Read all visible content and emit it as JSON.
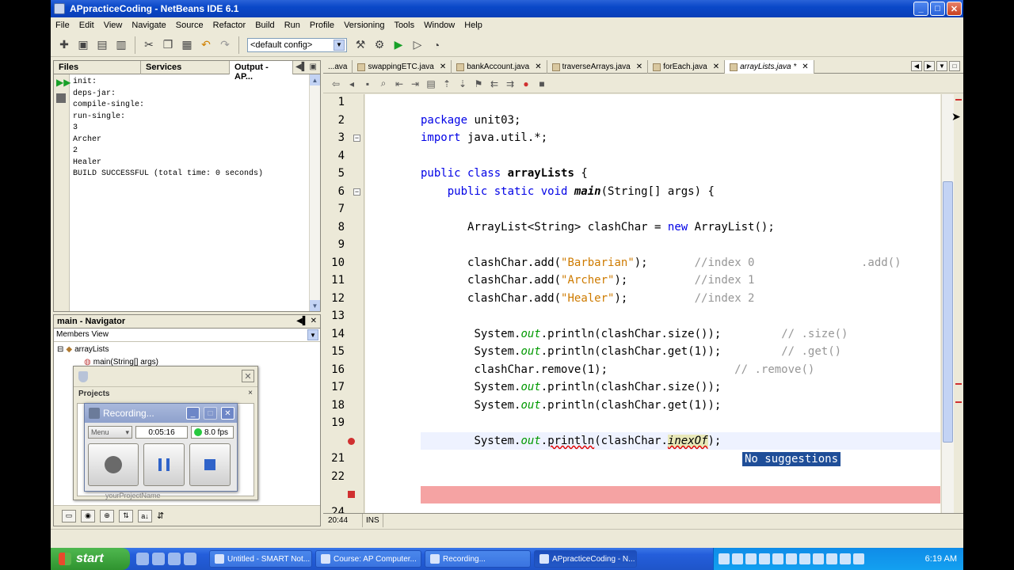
{
  "window": {
    "title": "APpracticeCoding - NetBeans IDE 6.1",
    "minimize": "_",
    "maximize": "□",
    "close": "✕"
  },
  "menu": [
    "File",
    "Edit",
    "View",
    "Navigate",
    "Source",
    "Refactor",
    "Build",
    "Run",
    "Profile",
    "Versioning",
    "Tools",
    "Window",
    "Help"
  ],
  "toolbar": {
    "config": "<default config>"
  },
  "left_tabs": [
    "Files",
    "Services",
    "Output - AP..."
  ],
  "output_lines": [
    "init:",
    "deps-jar:",
    "compile-single:",
    "run-single:",
    "3",
    "Archer",
    "2",
    "Healer",
    "BUILD SUCCESSFUL (total time: 0 seconds)"
  ],
  "navigator": {
    "title": "main - Navigator",
    "view": "Members View",
    "class_node": "arrayLists",
    "method_node": "main(String[] args)"
  },
  "projects_panel": {
    "title": "Projects",
    "footer": "yourProjectName"
  },
  "recording": {
    "title": "Recording...",
    "menu": "Menu",
    "time": "0:05:16",
    "fps": "8.0 fps"
  },
  "editor_tabs": [
    "...ava",
    "swappingETC.java",
    "bankAccount.java",
    "traverseArrays.java",
    "forEach.java",
    "arrayLists.java *"
  ],
  "line_numbers": [
    "1",
    "2",
    "3",
    "4",
    "5",
    "6",
    "7",
    "8",
    "9",
    "10",
    "11",
    "12",
    "13",
    "14",
    "15",
    "16",
    "17",
    "18",
    "19",
    "",
    "21",
    "22",
    "",
    "24"
  ],
  "code": {
    "l2_kw": "package",
    "l2_rest": " unit03;",
    "l3_kw": "import",
    "l3_rest": " java.util.*;",
    "l5_kw": "public class",
    "l5_name": "arrayLists",
    "l5_rest": " {",
    "l6_kw": "public static void",
    "l6_name": "main",
    "l6_rest": "(String[] args) {",
    "l8_a": "ArrayList<String> clashChar = ",
    "l8_kw": "new",
    "l8_b": " ArrayList();",
    "l10_a": "clashChar.add(",
    "l10_s": "\"Barbarian\"",
    "l10_b": ");",
    "l10_c": "//index 0",
    "l10_d": ".add()",
    "l11_a": "clashChar.add(",
    "l11_s": "\"Archer\"",
    "l11_b": ");",
    "l11_c": "//index 1",
    "l12_a": "clashChar.add(",
    "l12_s": "\"Healer\"",
    "l12_b": ");",
    "l12_c": "//index 2",
    "sys": "System.",
    "out": "out",
    "l14_rest": ".println(clashChar.size());",
    "l14_c": "// .size()",
    "l15_rest": ".println(clashChar.get(1));",
    "l15_c": "// .get()",
    "l16": "clashChar.remove(1);",
    "l16_c": "// .remove()",
    "l17_rest": ".println(clashChar.size());",
    "l18_rest": ".println(clashChar.get(1));",
    "l20_dot": ".",
    "l20_println": "println",
    "l20_paren": "(clashChar.",
    "l20_method": "inexOf",
    "l20_end": ");"
  },
  "suggestion": "No suggestions",
  "status": {
    "position": "20:44",
    "mode": "INS"
  },
  "taskbar": {
    "start": "start",
    "buttons": [
      "Untitled - SMART Not...",
      "Course: AP Computer...",
      "Recording...",
      "APpracticeCoding - N..."
    ],
    "clock": "6:19 AM"
  }
}
